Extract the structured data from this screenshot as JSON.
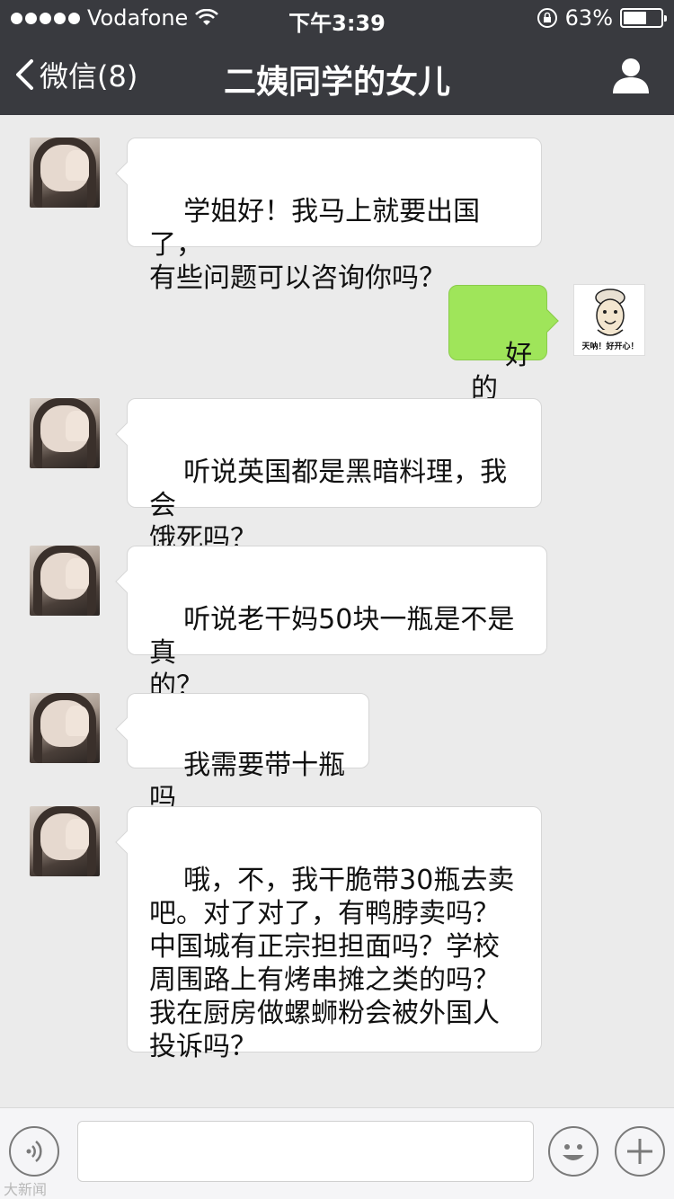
{
  "status_bar": {
    "carrier": "Vodafone",
    "time": "下午3:39",
    "battery_percent": "63%",
    "battery_level": 0.63
  },
  "nav": {
    "back_label": "微信(8)",
    "title": "二姨同学的女儿"
  },
  "messages": [
    {
      "sender": "other",
      "text": "学姐好！我马上就要出国了，\n有些问题可以咨询你吗？"
    },
    {
      "sender": "me",
      "text": "好的",
      "avatar_caption": "天呐！好开心！"
    },
    {
      "sender": "other",
      "text": "听说英国都是黑暗料理，我会\n饿死吗？"
    },
    {
      "sender": "other",
      "text": "听说老干妈50块一瓶是不是真\n的？"
    },
    {
      "sender": "other",
      "text": "我需要带十瓶吗"
    },
    {
      "sender": "other",
      "text": "哦，不，我干脆带30瓶去卖\n吧。对了对了，有鸭脖卖吗？\n中国城有正宗担担面吗？学校\n周围路上有烤串摊之类的吗？\n我在厨房做螺蛳粉会被外国人\n投诉吗？"
    }
  ],
  "input_bar": {
    "voice_icon": "voice-icon",
    "emoji_icon": "smiley-icon",
    "plus_icon": "plus-icon",
    "input_value": ""
  },
  "watermark": "大新闻"
}
